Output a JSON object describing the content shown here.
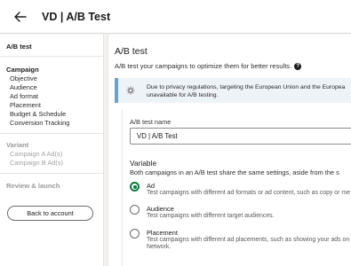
{
  "header": {
    "back_icon": "arrow-left-icon",
    "title": "VD | A/B Test"
  },
  "sidebar": {
    "ab_test_heading": "A/B test",
    "campaign_heading": "Campaign",
    "campaign_items": [
      "Objective",
      "Audience",
      "Ad format",
      "Placement",
      "Budget & Schedule",
      "Conversion Tracking"
    ],
    "variant_heading": "Variant",
    "variant_items": [
      "Campaign A Ad(s)",
      "Campaign B Ad(s)"
    ],
    "review_heading": "Review & launch",
    "back_button": "Back to account"
  },
  "main": {
    "title": "A/B test",
    "subtitle": "A/B test your campaigns to optimize them for better results.",
    "help_icon": "help-circle-icon",
    "notice": {
      "icon": "lightbulb-icon",
      "line1": "Due to privacy regulations, targeting the European Union and the Europea",
      "line2": "unavailable for A/B testing."
    },
    "name_field": {
      "label": "A/B test name",
      "value": "VD | A/B Test"
    },
    "variable": {
      "title": "Variable",
      "description": "Both campaigns in an A/B test share the same settings, aside from the s",
      "options": [
        {
          "label": "Ad",
          "desc1": "Test campaigns with different ad formats or ad content, such as copy or me",
          "selected": true
        },
        {
          "label": "Audience",
          "desc1": "Test campaigns with different target audiences.",
          "selected": false
        },
        {
          "label": "Placement",
          "desc1": "Test campaigns with different ad placements, such as showing your ads on",
          "desc2": "Network.",
          "selected": false
        }
      ]
    }
  },
  "colors": {
    "accent_green": "#0a7a3b",
    "notice_bar": "#70a0c8",
    "notice_bg": "#eef3f8"
  }
}
